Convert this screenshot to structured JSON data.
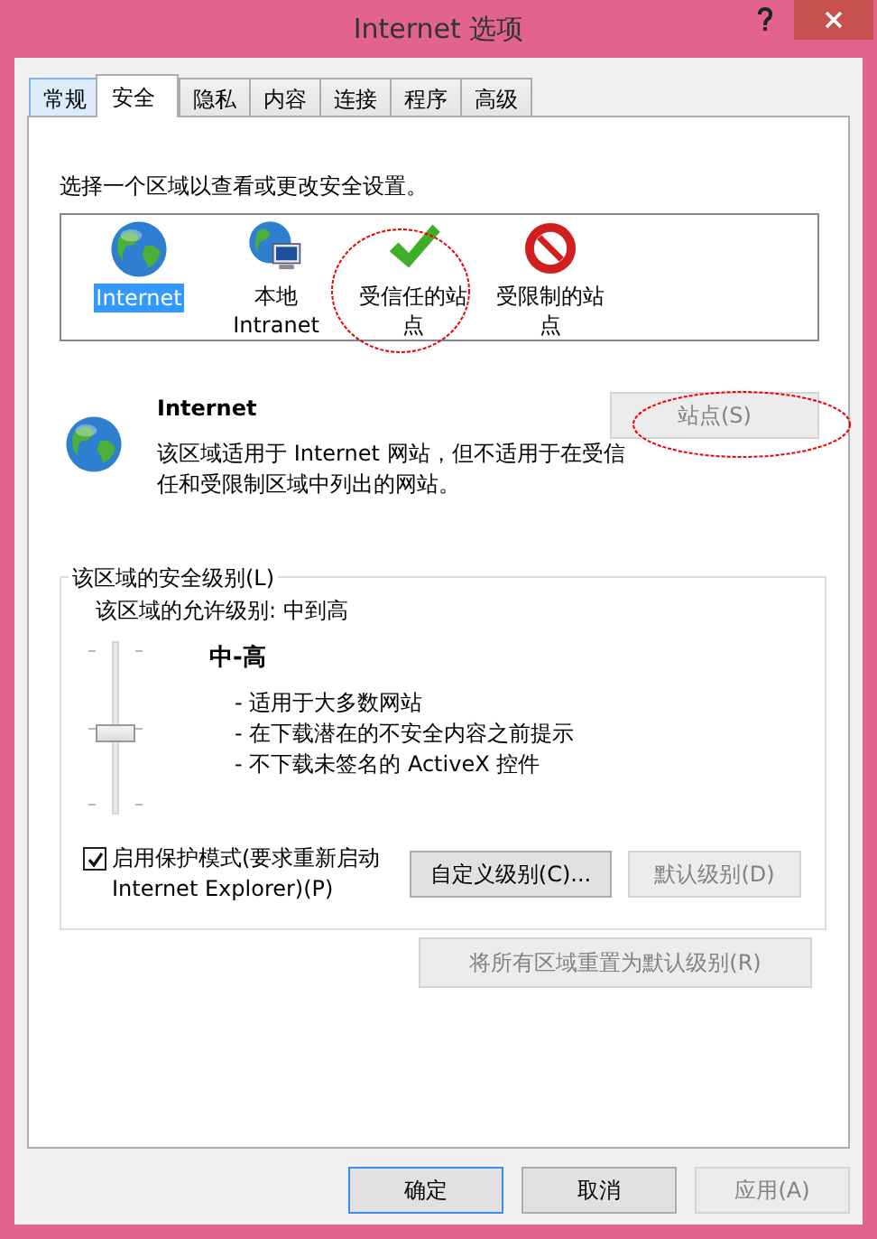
{
  "window": {
    "title": "Internet 选项"
  },
  "tabs": [
    {
      "label": "常规",
      "selected": false
    },
    {
      "label": "安全",
      "selected": true
    },
    {
      "label": "隐私",
      "selected": false
    },
    {
      "label": "内容",
      "selected": false
    },
    {
      "label": "连接",
      "selected": false
    },
    {
      "label": "程序",
      "selected": false
    },
    {
      "label": "高级",
      "selected": false
    }
  ],
  "instruction": "选择一个区域以查看或更改安全设置。",
  "zones": [
    {
      "label": "Internet",
      "kind": "internet",
      "selected": true
    },
    {
      "label": "本地 Intranet",
      "kind": "intranet",
      "selected": false
    },
    {
      "label": "受信任的站点",
      "kind": "trusted",
      "selected": false
    },
    {
      "label": "受限制的站点",
      "kind": "restricted",
      "selected": false
    }
  ],
  "zone_detail": {
    "name": "Internet",
    "kind": "internet",
    "description": "该区域适用于 Internet 网站，但不适用于在受信任和受限制区域中列出的网站。",
    "sites_button": {
      "label": "站点(S)",
      "disabled": true
    }
  },
  "security_level": {
    "legend": "该区域的安全级别(L)",
    "allowed": "该区域的允许级别: 中到高",
    "level": 0.5,
    "level_name": "中-高",
    "bullets": [
      "- 适用于大多数网站",
      "- 在下载潜在的不安全内容之前提示",
      "- 不下载未签名的 ActiveX 控件"
    ],
    "protected_mode": {
      "label": "启用保护模式(要求重新启动 Internet Explorer)(P)",
      "checked": true
    },
    "buttons": [
      {
        "label": "自定义级别(C)...",
        "disabled": false
      },
      {
        "label": "默认级别(D)",
        "disabled": true
      }
    ]
  },
  "reset_button": {
    "label": "将所有区域重置为默认级别(R)",
    "disabled": true
  },
  "footer_buttons": [
    {
      "label": "确定",
      "default": true,
      "disabled": false
    },
    {
      "label": "取消",
      "default": false,
      "disabled": false
    },
    {
      "label": "应用(A)",
      "default": false,
      "disabled": true
    }
  ]
}
